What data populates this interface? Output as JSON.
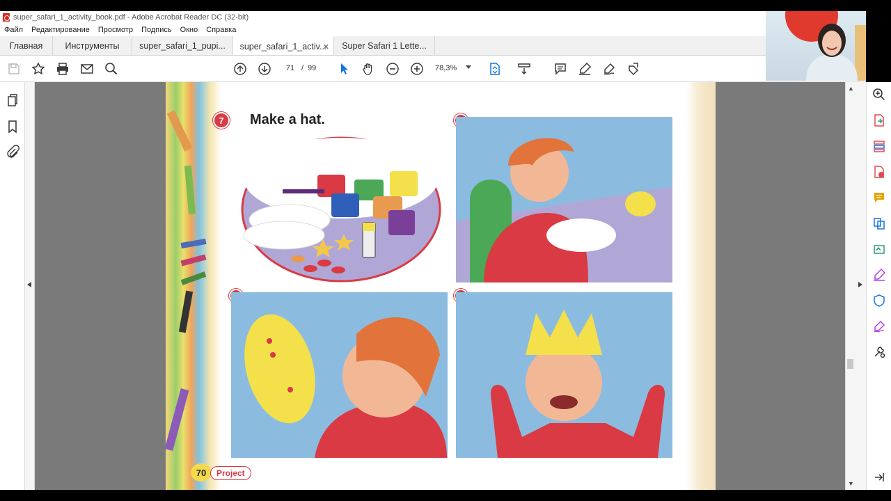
{
  "window": {
    "title": "super_safari_1_activity_book.pdf - Adobe Acrobat Reader DC (32-bit)"
  },
  "menu": [
    "Файл",
    "Редактирование",
    "Просмотр",
    "Подпись",
    "Окно",
    "Справка"
  ],
  "tabs": {
    "home": "Главная",
    "tools": "Инструменты",
    "documents": [
      {
        "label": "super_safari_1_pupi...",
        "active": false,
        "closable": false
      },
      {
        "label": "super_safari_1_activ...",
        "active": true,
        "closable": true
      },
      {
        "label": "Super Safari 1 Lette...",
        "active": false,
        "closable": false
      }
    ]
  },
  "toolbar": {
    "current_page": "71",
    "page_separator": "/",
    "total_pages": "99",
    "zoom": "78,3%",
    "icons": [
      "save-icon",
      "bookmark-star-icon",
      "print-icon",
      "email-icon",
      "search-icon",
      "page-up-icon",
      "page-down-icon",
      "select-cursor-icon",
      "hand-icon",
      "zoom-out-icon",
      "zoom-in-icon",
      "fit-page-icon",
      "scroll-mode-icon",
      "comment-icon",
      "highlight-icon",
      "sign-icon",
      "share-icon"
    ]
  },
  "left_rail_icons": [
    "page-thumbnails-icon",
    "bookmarks-icon",
    "attachments-icon"
  ],
  "right_rail_icons": [
    "zoom-search-icon",
    "export-pdf-icon",
    "organize-pages-icon",
    "create-pdf-icon",
    "comment-tool-icon",
    "combine-files-icon",
    "edit-pdf-icon",
    "fill-sign-icon",
    "protect-icon",
    "sign-pen-icon",
    "more-tools-icon"
  ],
  "pdf_page": {
    "activity_number": "7",
    "title": "Make a hat.",
    "steps": [
      "1",
      "2",
      "3"
    ],
    "page_number": "70",
    "section_label": "Project"
  },
  "colors": {
    "accent_red": "#d93a44",
    "acrobat_red": "#d9261c",
    "panel_blue": "#8bbce0",
    "viewer_gray": "#7a7a7a"
  }
}
